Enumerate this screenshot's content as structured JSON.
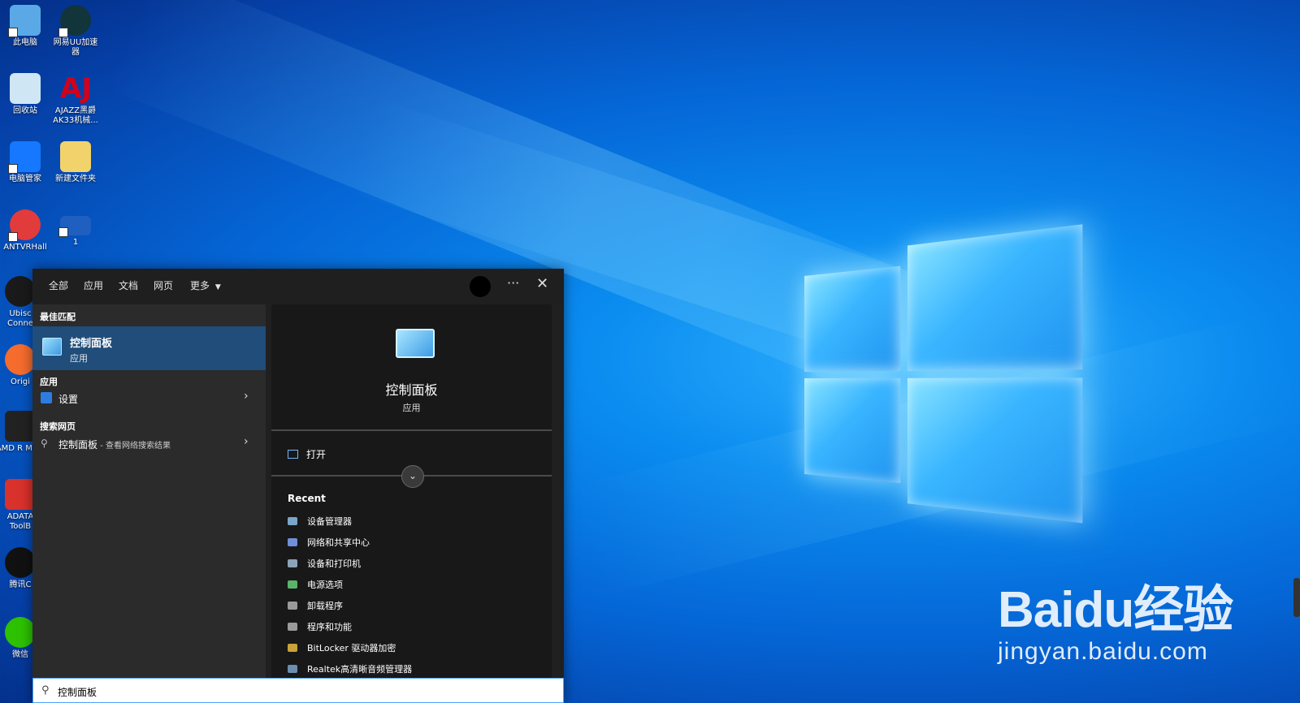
{
  "desktop": {
    "icons": [
      {
        "label": "此电脑",
        "icon": "computer-icon",
        "color": "#5aa9e6"
      },
      {
        "label": "网易UU加速器",
        "icon": "uu-accelerator-icon",
        "color": "#12343b"
      },
      {
        "label": "回收站",
        "icon": "recycle-bin-icon",
        "color": "#cfe6f5"
      },
      {
        "label": "AJAZZ黑爵AK33机械...",
        "icon": "ajazz-icon",
        "color": "#d0021b"
      },
      {
        "label": "电脑管家",
        "icon": "pc-manager-icon",
        "color": "#1677ff"
      },
      {
        "label": "新建文件夹",
        "icon": "folder-icon",
        "color": "#f2d36b"
      },
      {
        "label": "ANTVRHall",
        "icon": "antvr-icon",
        "color": "#e23b3b"
      },
      {
        "label": "1",
        "icon": "monitor-icon",
        "color": "#1f5fbf"
      },
      {
        "label": "Ubisc Conne",
        "icon": "ubisoft-icon",
        "color": "#1a1a1a"
      },
      {
        "label": "Origi",
        "icon": "origin-icon",
        "color": "#f56c2d"
      },
      {
        "label": "AMD R Mast",
        "icon": "amd-ryzen-icon",
        "color": "#222222"
      },
      {
        "label": "ADATA ToolB",
        "icon": "adata-icon",
        "color": "#d9312b"
      },
      {
        "label": "腾讯C",
        "icon": "qq-icon",
        "color": "#111111"
      },
      {
        "label": "微信",
        "icon": "wechat-icon",
        "color": "#2dc100"
      }
    ]
  },
  "search": {
    "tabs": [
      "全部",
      "应用",
      "文档",
      "网页"
    ],
    "more_label": "更多",
    "dots": "···",
    "close": "✕",
    "best_match_header": "最佳匹配",
    "best_match": {
      "title": "控制面板",
      "subtitle": "应用"
    },
    "apps_header": "应用",
    "apps": [
      {
        "label": "设置"
      }
    ],
    "web_header": "搜索网页",
    "web_item": {
      "label": "控制面板",
      "suffix": " - 查看网络搜索结果"
    },
    "preview": {
      "title": "控制面板",
      "subtitle": "应用",
      "open_label": "打开"
    },
    "recent_header": "Recent",
    "recent": [
      "设备管理器",
      "网络和共享中心",
      "设备和打印机",
      "电源选项",
      "卸载程序",
      "程序和功能",
      "BitLocker 驱动器加密",
      "Realtek高清晰音频管理器"
    ],
    "query": "控制面板"
  },
  "watermark": {
    "line1": "Baidu经验",
    "line2": "jingyan.baidu.com"
  },
  "colors": {
    "accent": "#4da3ff",
    "selection": "#204d7a",
    "panel": "#202020"
  }
}
